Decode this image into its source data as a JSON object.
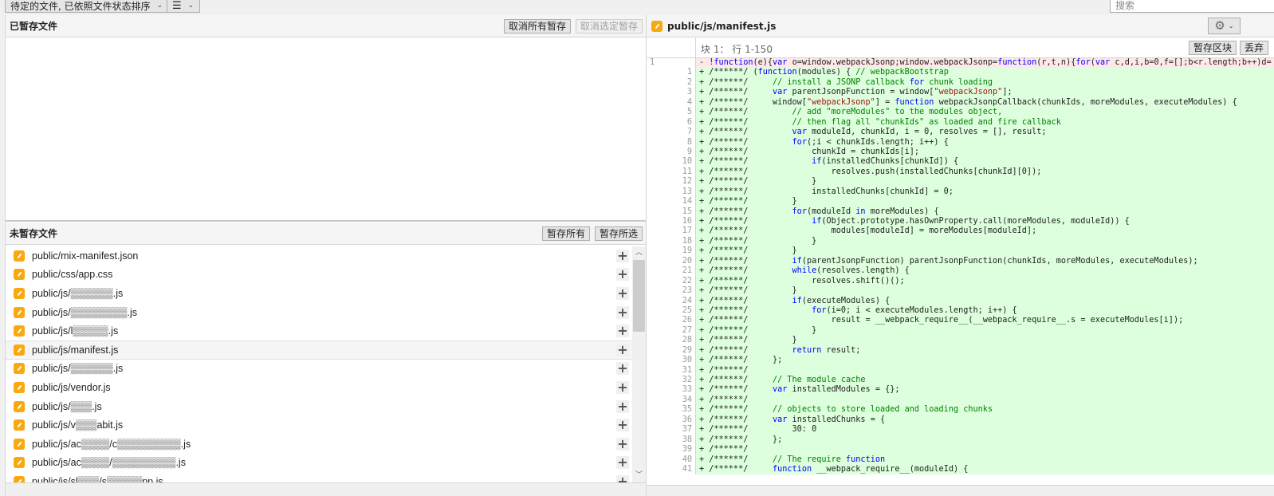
{
  "toolbar": {
    "filter_dropdown": "待定的文件, 已依照文件状态排序",
    "view_dropdown_icon": "list-icon",
    "search_placeholder": "搜索"
  },
  "staged": {
    "title": "已暂存文件",
    "unstage_all": "取消所有暂存",
    "unstage_selected": "取消选定暂存"
  },
  "unstaged": {
    "title": "未暂存文件",
    "stage_all": "暂存所有",
    "stage_selected": "暂存所选",
    "files": [
      {
        "name": "public/mix-manifest.json",
        "selected": false
      },
      {
        "name": "public/css/app.css",
        "selected": false
      },
      {
        "name": "public/js/▒▒▒▒▒▒.js",
        "selected": false
      },
      {
        "name": "public/js/▒▒▒▒▒▒▒▒.js",
        "selected": false
      },
      {
        "name": "public/js/l▒▒▒▒▒.js",
        "selected": false
      },
      {
        "name": "public/js/manifest.js",
        "selected": true
      },
      {
        "name": "public/js/▒▒▒▒▒▒.js",
        "selected": false
      },
      {
        "name": "public/js/vendor.js",
        "selected": false
      },
      {
        "name": "public/js/▒▒▒.js",
        "selected": false
      },
      {
        "name": "public/js/v▒▒▒abit.js",
        "selected": false
      },
      {
        "name": "public/js/ac▒▒▒▒/c▒▒▒▒▒▒▒▒▒.js",
        "selected": false
      },
      {
        "name": "public/js/ac▒▒▒▒/▒▒▒▒▒▒▒▒▒.js",
        "selected": false
      },
      {
        "name": "public/js/sl▒▒▒/s▒▒▒▒▒pp.js",
        "selected": false
      }
    ]
  },
  "diff": {
    "file": "public/js/manifest.js",
    "hunk_label": "块 1： 行 1-150",
    "stage_hunk": "暂存区块",
    "discard_hunk": "丢弃",
    "lines": [
      {
        "old": "1",
        "new": "",
        "type": "del",
        "text": "- !function(e){var o=window.webpackJsonp;window.webpackJsonp=function(r,t,n){for(var c,d,i,b=0,f=[];b<r.length;b++)d="
      },
      {
        "old": "",
        "new": "1",
        "type": "add",
        "text": "+ /******/ (function(modules) { // webpackBootstrap"
      },
      {
        "old": "",
        "new": "2",
        "type": "add",
        "text": "+ /******/     // install a JSONP callback for chunk loading"
      },
      {
        "old": "",
        "new": "3",
        "type": "add",
        "text": "+ /******/     var parentJsonpFunction = window[\"webpackJsonp\"];"
      },
      {
        "old": "",
        "new": "4",
        "type": "add",
        "text": "+ /******/     window[\"webpackJsonp\"] = function webpackJsonpCallback(chunkIds, moreModules, executeModules) {"
      },
      {
        "old": "",
        "new": "5",
        "type": "add",
        "text": "+ /******/         // add \"moreModules\" to the modules object,"
      },
      {
        "old": "",
        "new": "6",
        "type": "add",
        "text": "+ /******/         // then flag all \"chunkIds\" as loaded and fire callback"
      },
      {
        "old": "",
        "new": "7",
        "type": "add",
        "text": "+ /******/         var moduleId, chunkId, i = 0, resolves = [], result;"
      },
      {
        "old": "",
        "new": "8",
        "type": "add",
        "text": "+ /******/         for(;i < chunkIds.length; i++) {"
      },
      {
        "old": "",
        "new": "9",
        "type": "add",
        "text": "+ /******/             chunkId = chunkIds[i];"
      },
      {
        "old": "",
        "new": "10",
        "type": "add",
        "text": "+ /******/             if(installedChunks[chunkId]) {"
      },
      {
        "old": "",
        "new": "11",
        "type": "add",
        "text": "+ /******/                 resolves.push(installedChunks[chunkId][0]);"
      },
      {
        "old": "",
        "new": "12",
        "type": "add",
        "text": "+ /******/             }"
      },
      {
        "old": "",
        "new": "13",
        "type": "add",
        "text": "+ /******/             installedChunks[chunkId] = 0;"
      },
      {
        "old": "",
        "new": "14",
        "type": "add",
        "text": "+ /******/         }"
      },
      {
        "old": "",
        "new": "15",
        "type": "add",
        "text": "+ /******/         for(moduleId in moreModules) {"
      },
      {
        "old": "",
        "new": "16",
        "type": "add",
        "text": "+ /******/             if(Object.prototype.hasOwnProperty.call(moreModules, moduleId)) {"
      },
      {
        "old": "",
        "new": "17",
        "type": "add",
        "text": "+ /******/                 modules[moduleId] = moreModules[moduleId];"
      },
      {
        "old": "",
        "new": "18",
        "type": "add",
        "text": "+ /******/             }"
      },
      {
        "old": "",
        "new": "19",
        "type": "add",
        "text": "+ /******/         }"
      },
      {
        "old": "",
        "new": "20",
        "type": "add",
        "text": "+ /******/         if(parentJsonpFunction) parentJsonpFunction(chunkIds, moreModules, executeModules);"
      },
      {
        "old": "",
        "new": "21",
        "type": "add",
        "text": "+ /******/         while(resolves.length) {"
      },
      {
        "old": "",
        "new": "22",
        "type": "add",
        "text": "+ /******/             resolves.shift()();"
      },
      {
        "old": "",
        "new": "23",
        "type": "add",
        "text": "+ /******/         }"
      },
      {
        "old": "",
        "new": "24",
        "type": "add",
        "text": "+ /******/         if(executeModules) {"
      },
      {
        "old": "",
        "new": "25",
        "type": "add",
        "text": "+ /******/             for(i=0; i < executeModules.length; i++) {"
      },
      {
        "old": "",
        "new": "26",
        "type": "add",
        "text": "+ /******/                 result = __webpack_require__(__webpack_require__.s = executeModules[i]);"
      },
      {
        "old": "",
        "new": "27",
        "type": "add",
        "text": "+ /******/             }"
      },
      {
        "old": "",
        "new": "28",
        "type": "add",
        "text": "+ /******/         }"
      },
      {
        "old": "",
        "new": "29",
        "type": "add",
        "text": "+ /******/         return result;"
      },
      {
        "old": "",
        "new": "30",
        "type": "add",
        "text": "+ /******/     };"
      },
      {
        "old": "",
        "new": "31",
        "type": "add",
        "text": "+ /******/"
      },
      {
        "old": "",
        "new": "32",
        "type": "add",
        "text": "+ /******/     // The module cache"
      },
      {
        "old": "",
        "new": "33",
        "type": "add",
        "text": "+ /******/     var installedModules = {};"
      },
      {
        "old": "",
        "new": "34",
        "type": "add",
        "text": "+ /******/"
      },
      {
        "old": "",
        "new": "35",
        "type": "add",
        "text": "+ /******/     // objects to store loaded and loading chunks"
      },
      {
        "old": "",
        "new": "36",
        "type": "add",
        "text": "+ /******/     var installedChunks = {"
      },
      {
        "old": "",
        "new": "37",
        "type": "add",
        "text": "+ /******/         30: 0"
      },
      {
        "old": "",
        "new": "38",
        "type": "add",
        "text": "+ /******/     };"
      },
      {
        "old": "",
        "new": "39",
        "type": "add",
        "text": "+ /******/"
      },
      {
        "old": "",
        "new": "40",
        "type": "add",
        "text": "+ /******/     // The require function"
      },
      {
        "old": "",
        "new": "41",
        "type": "add",
        "text": "+ /******/     function __webpack_require__(moduleId) {"
      }
    ]
  }
}
